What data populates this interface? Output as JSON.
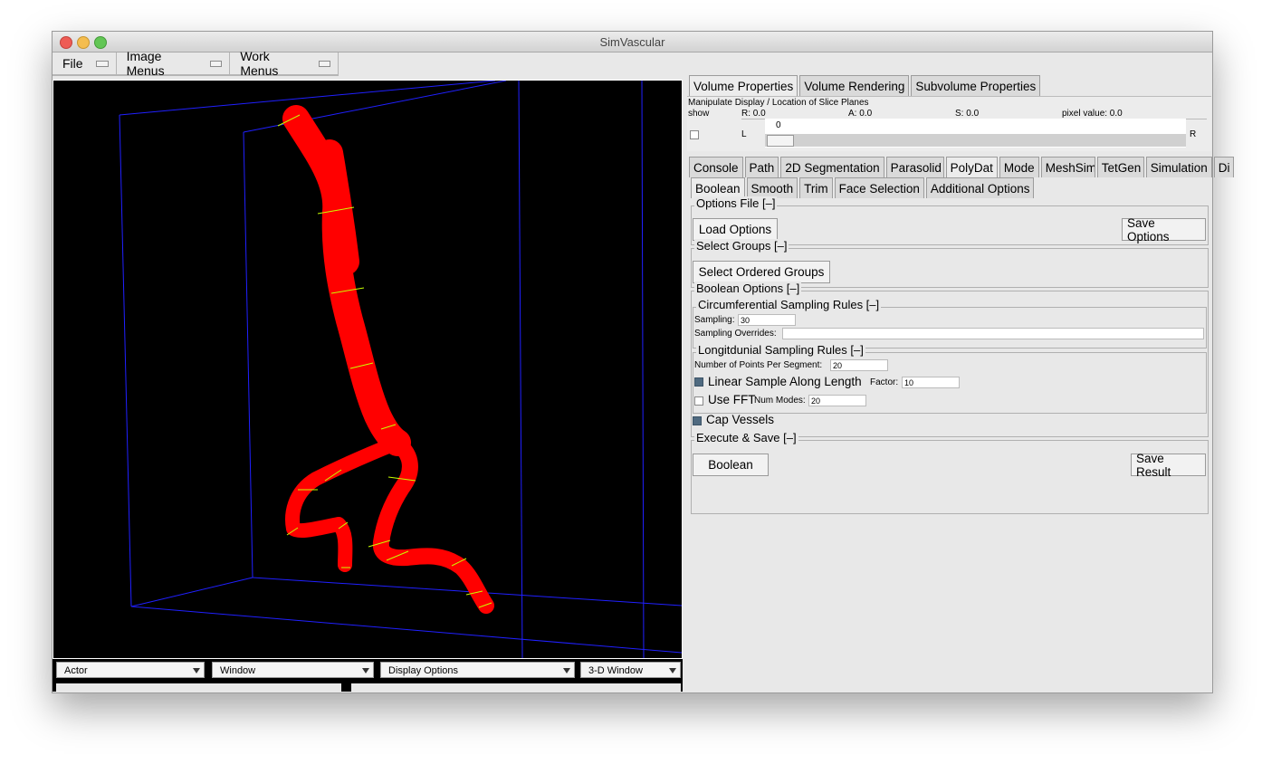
{
  "window": {
    "title": "SimVascular"
  },
  "menubar": {
    "items": [
      "File",
      "Image Menus",
      "Work Menus"
    ]
  },
  "viewport": {
    "controls": [
      "Actor",
      "Window",
      "Display Options",
      "3-D Window"
    ]
  },
  "volume_tabs": [
    "Volume Properties",
    "Volume Rendering",
    "Subvolume Properties"
  ],
  "slice": {
    "heading": "Manipulate Display / Location of Slice Planes",
    "show_label": "show",
    "r_label": "R: 0.0",
    "a_label": "A: 0.0",
    "s_label": "S: 0.0",
    "pixel_label": "pixel value: 0.0",
    "left_label": "L",
    "right_label": "R",
    "slider_value": "0"
  },
  "main_tabs": [
    "Console",
    "Path",
    "2D Segmentation",
    "Parasolid",
    "PolyDat",
    "Mode",
    "MeshSim",
    "TetGen",
    "Simulation",
    "Di"
  ],
  "sub_tabs": [
    "Boolean",
    "Smooth",
    "Trim",
    "Face Selection",
    "Additional Options"
  ],
  "options_file": {
    "title": "Options File [–]",
    "load": "Load Options",
    "save": "Save Options"
  },
  "select_groups": {
    "title": "Select Groups [–]",
    "button": "Select Ordered Groups"
  },
  "boolean_options": {
    "title": "Boolean Options [–]",
    "circ": {
      "title": "Circumferential Sampling Rules [–]",
      "sampling_label": "Sampling:",
      "sampling_value": "30",
      "overrides_label": "Sampling Overrides:",
      "overrides_value": ""
    },
    "long": {
      "title": "Longitdunial Sampling Rules [–]",
      "points_label": "Number of Points Per Segment:",
      "points_value": "20",
      "linear_label": "Linear Sample Along Length",
      "factor_label": "Factor:",
      "factor_value": "10",
      "fft_label": "Use FFT",
      "modes_label": "Num Modes:",
      "modes_value": "20"
    },
    "cap_label": "Cap Vessels"
  },
  "execute": {
    "title": "Execute & Save [–]",
    "boolean": "Boolean",
    "save_result": "Save Result"
  },
  "colors": {
    "vessel": "#ff0000",
    "box_lines": "#2020ff",
    "ring": "#c8ff00"
  }
}
